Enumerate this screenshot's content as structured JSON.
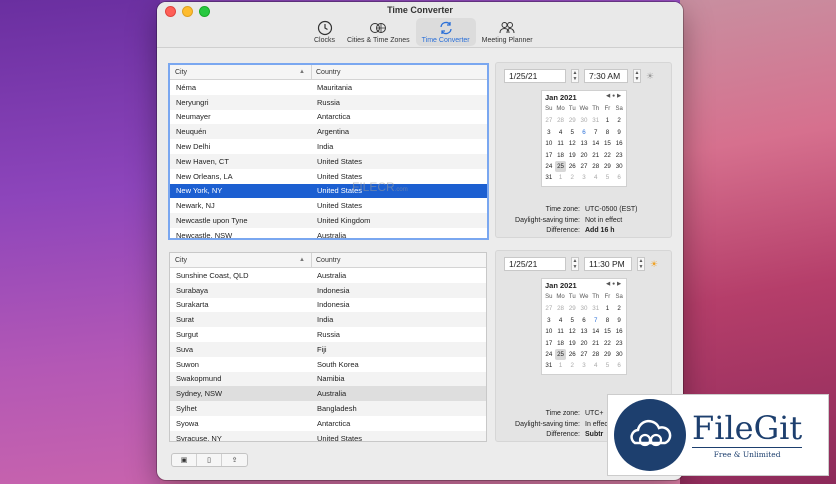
{
  "window": {
    "title": "Time Converter"
  },
  "toolbar": {
    "items": [
      {
        "label": "Clocks"
      },
      {
        "label": "Cities & Time Zones"
      },
      {
        "label": "Time Converter"
      },
      {
        "label": "Meeting Planner"
      }
    ]
  },
  "table_header": {
    "city": "City",
    "country": "Country"
  },
  "top_table": {
    "rows": [
      {
        "city": "Néma",
        "country": "Mauritania"
      },
      {
        "city": "Neryungri",
        "country": "Russia"
      },
      {
        "city": "Neumayer",
        "country": "Antarctica"
      },
      {
        "city": "Neuquén",
        "country": "Argentina"
      },
      {
        "city": "New Delhi",
        "country": "India"
      },
      {
        "city": "New Haven, CT",
        "country": "United States"
      },
      {
        "city": "New Orleans, LA",
        "country": "United States"
      },
      {
        "city": "New York, NY",
        "country": "United States"
      },
      {
        "city": "Newark, NJ",
        "country": "United States"
      },
      {
        "city": "Newcastle upon Tyne",
        "country": "United Kingdom"
      },
      {
        "city": "Newcastle, NSW",
        "country": "Australia"
      }
    ]
  },
  "bottom_table": {
    "rows": [
      {
        "city": "Sunshine Coast, QLD",
        "country": "Australia"
      },
      {
        "city": "Surabaya",
        "country": "Indonesia"
      },
      {
        "city": "Surakarta",
        "country": "Indonesia"
      },
      {
        "city": "Surat",
        "country": "India"
      },
      {
        "city": "Surgut",
        "country": "Russia"
      },
      {
        "city": "Suva",
        "country": "Fiji"
      },
      {
        "city": "Suwon",
        "country": "South Korea"
      },
      {
        "city": "Swakopmund",
        "country": "Namibia"
      },
      {
        "city": "Sydney, NSW",
        "country": "Australia"
      },
      {
        "city": "Sylhet",
        "country": "Bangladesh"
      },
      {
        "city": "Syowa",
        "country": "Antarctica"
      },
      {
        "city": "Syracuse, NY",
        "country": "United States"
      }
    ]
  },
  "top_converter": {
    "date": "1/25/21",
    "time": "7:30  AM",
    "calendar": {
      "month": "Jan 2021",
      "day_names": [
        "Su",
        "Mo",
        "Tu",
        "We",
        "Th",
        "Fr",
        "Sa"
      ],
      "days": [
        "27",
        "28",
        "29",
        "30",
        "31",
        "1",
        "2",
        "3",
        "4",
        "5",
        "6",
        "7",
        "8",
        "9",
        "10",
        "11",
        "12",
        "13",
        "14",
        "15",
        "16",
        "17",
        "18",
        "19",
        "20",
        "21",
        "22",
        "23",
        "24",
        "25",
        "26",
        "27",
        "28",
        "29",
        "30",
        "31",
        "1",
        "2",
        "3",
        "4",
        "5",
        "6"
      ]
    },
    "info": {
      "tz_label": "Time zone:",
      "tz_value": "UTC-0500 (EST)",
      "dst_label": "Daylight-saving time:",
      "dst_value": "Not in effect",
      "diff_label": "Difference:",
      "diff_value": "Add 16 h"
    }
  },
  "bottom_converter": {
    "date": "1/25/21",
    "time": "11:30  PM",
    "calendar": {
      "month": "Jan 2021",
      "day_names": [
        "Su",
        "Mo",
        "Tu",
        "We",
        "Th",
        "Fr",
        "Sa"
      ],
      "days": [
        "27",
        "28",
        "29",
        "30",
        "31",
        "1",
        "2",
        "3",
        "4",
        "5",
        "6",
        "7",
        "8",
        "9",
        "10",
        "11",
        "12",
        "13",
        "14",
        "15",
        "16",
        "17",
        "18",
        "19",
        "20",
        "21",
        "22",
        "23",
        "24",
        "25",
        "26",
        "27",
        "28",
        "29",
        "30",
        "31",
        "1",
        "2",
        "3",
        "4",
        "5",
        "6"
      ]
    },
    "info": {
      "tz_label": "Time zone:",
      "tz_value": "UTC+",
      "dst_label": "Daylight-saving time:",
      "dst_value": "In effect",
      "diff_label": "Difference:",
      "diff_value": "Subtr"
    }
  },
  "watermark": {
    "text": "FILECR",
    "sub": ".com"
  },
  "filegit": {
    "name": "FileGit",
    "tagline": "Free & Unlimited"
  },
  "colors": {
    "accent": "#1c5fd1",
    "focus": "#7aa7f0",
    "brand": "#1d3f6e"
  }
}
